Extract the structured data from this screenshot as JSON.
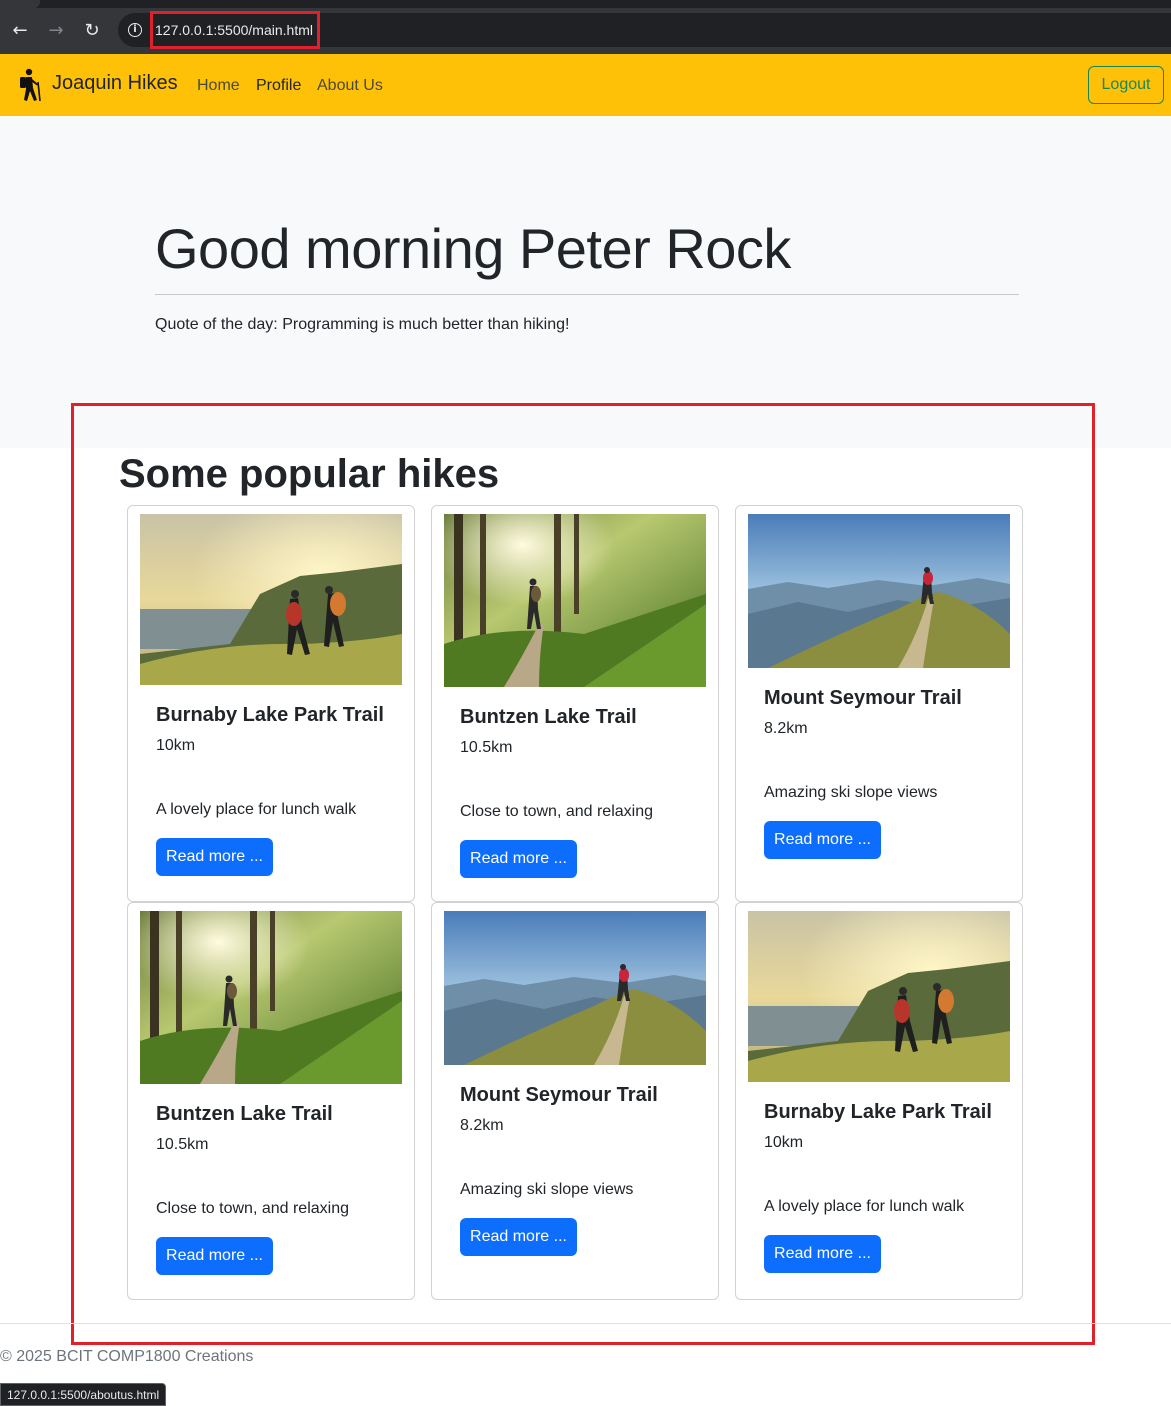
{
  "browser": {
    "url": "127.0.0.1:5500/main.html",
    "status_url": "127.0.0.1:5500/aboutus.html"
  },
  "navbar": {
    "brand": "Joaquin Hikes",
    "links": [
      "Home",
      "Profile",
      "About Us"
    ],
    "logout_label": "Logout",
    "bg_color": "#ffc107"
  },
  "hero": {
    "greeting": "Good morning Peter Rock",
    "quote": "Quote of the day: Programming is much better than hiking!"
  },
  "section": {
    "title": "Some popular hikes"
  },
  "cards": [
    {
      "title": "Burnaby Lake Park Trail",
      "distance": "10km",
      "description": "A lovely place for lunch walk",
      "button": "Read more ...",
      "image": "hikers-sunset-coast"
    },
    {
      "title": "Buntzen Lake Trail",
      "distance": "10.5km",
      "description": "Close to town, and relaxing",
      "button": "Read more ...",
      "image": "forest-trail-sun"
    },
    {
      "title": "Mount Seymour Trail",
      "distance": "8.2km",
      "description": "Amazing ski slope views",
      "button": "Read more ...",
      "image": "mountain-ridge-hiker"
    },
    {
      "title": "Buntzen Lake Trail",
      "distance": "10.5km",
      "description": "Close to town, and relaxing",
      "button": "Read more ...",
      "image": "forest-trail-sun"
    },
    {
      "title": "Mount Seymour Trail",
      "distance": "8.2km",
      "description": "Amazing ski slope views",
      "button": "Read more ...",
      "image": "mountain-ridge-hiker"
    },
    {
      "title": "Burnaby Lake Park Trail",
      "distance": "10km",
      "description": "A lovely place for lunch walk",
      "button": "Read more ...",
      "image": "hikers-sunset-coast"
    }
  ],
  "footer": {
    "text": "© 2025 BCIT COMP1800 Creations"
  },
  "colors": {
    "primary": "#0d6efd",
    "success": "#198754",
    "highlight": "#e0202a"
  }
}
